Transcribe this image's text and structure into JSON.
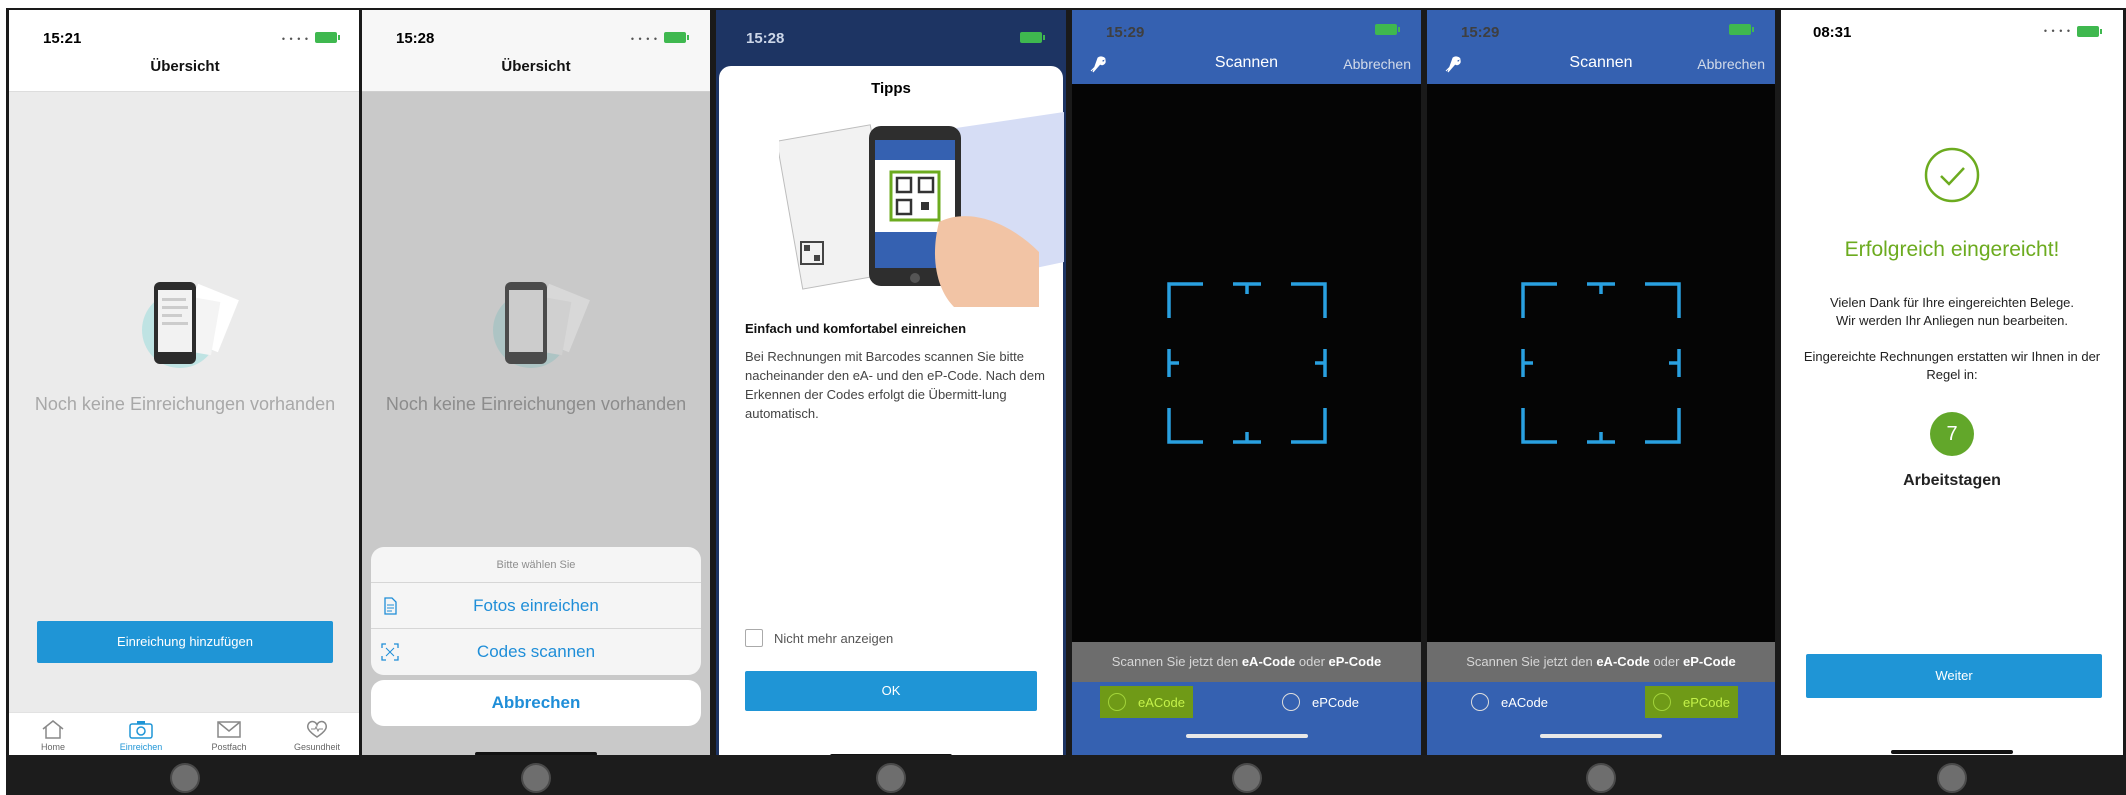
{
  "screens": [
    {
      "time": "15:21",
      "title": "Übersicht",
      "empty_text": "Noch keine Einreichungen vorhanden",
      "add_button": "Einreichung hinzufügen",
      "tabs": [
        {
          "label": "Home",
          "icon": "home-icon"
        },
        {
          "label": "Einreichen",
          "icon": "camera-icon"
        },
        {
          "label": "Postfach",
          "icon": "mail-icon"
        },
        {
          "label": "Gesundheit",
          "icon": "heart-icon"
        }
      ]
    },
    {
      "time": "15:28",
      "title": "Übersicht",
      "empty_text": "Noch keine Einreichungen vorhanden",
      "sheet_header": "Bitte wählen Sie",
      "option_photos": "Fotos einreichen",
      "option_codes": "Codes scannen",
      "cancel": "Abbrechen"
    },
    {
      "time": "15:28",
      "title": "Tipps",
      "heading": "Einfach und komfortabel einreichen",
      "body": "Bei Rechnungen mit Barcodes scannen Sie bitte nacheinander den eA- und den eP-Code. Nach dem Erkennen der Codes erfolgt die Übermitt-lung automatisch.",
      "checkbox_label": "Nicht mehr anzeigen",
      "ok": "OK"
    },
    {
      "time": "15:29",
      "title": "Scannen",
      "abort": "Abbrechen",
      "hint_prefix": "Scannen Sie jetzt den ",
      "hint_code1": "eA-Code",
      "hint_mid": " oder ",
      "hint_code2": "eP-Code",
      "toggle_a": "eACode",
      "toggle_p": "ePCode",
      "selected": "eACode"
    },
    {
      "time": "15:29",
      "title": "Scannen",
      "abort": "Abbrechen",
      "hint_prefix": "Scannen Sie jetzt den ",
      "hint_code1": "eA-Code",
      "hint_mid": " oder ",
      "hint_code2": "eP-Code",
      "toggle_a": "eACode",
      "toggle_p": "ePCode",
      "selected": "ePCode"
    },
    {
      "time": "08:31",
      "title": "Erfolgreich eingereicht!",
      "thanks_line1": "Vielen Dank für Ihre eingereichten Belege.",
      "thanks_line2": "Wir werden Ihr Anliegen nun bearbeiten.",
      "info_line1": "Eingereichte Rechnungen erstatten wir Ihnen in der",
      "info_line2": "Regel in:",
      "days": "7",
      "days_label": "Arbeitstagen",
      "next": "Weiter"
    }
  ],
  "colors": {
    "accent": "#1f95d6",
    "scan_blue": "#3561b1",
    "success_green": "#6cab1f",
    "battery_green": "#3fb84f"
  }
}
